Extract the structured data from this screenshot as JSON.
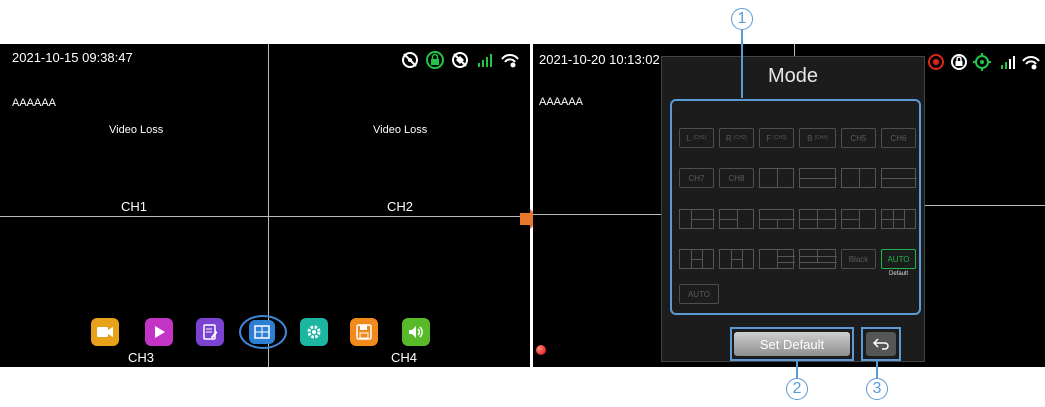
{
  "left_screen": {
    "timestamp": "2021-10-15 09:38:47",
    "plate": "AAAAAA",
    "ch1_status": "Video Loss",
    "ch2_status": "Video Loss",
    "channels": [
      "CH1",
      "CH2",
      "CH3",
      "CH4"
    ],
    "status_icons": [
      "gps-off-icon",
      "record-lock-icon",
      "wifi-off-icon",
      "signal-bars-icon",
      "wifi-icon"
    ],
    "dock": [
      {
        "name": "camera",
        "color": "#e6a21a"
      },
      {
        "name": "playback",
        "color": "#c233c6"
      },
      {
        "name": "notes",
        "color": "#7a43d1"
      },
      {
        "name": "layout",
        "color": "#2d7fd6"
      },
      {
        "name": "settings",
        "color": "#1fb5a3"
      },
      {
        "name": "storage",
        "color": "#f08a1c"
      },
      {
        "name": "volume",
        "color": "#58b92a"
      }
    ]
  },
  "right_screen": {
    "timestamp": "2021-10-20 10:13:02",
    "plate": "AAAAAA",
    "status_icons": [
      "record-icon",
      "lock-icon",
      "gps-icon",
      "signal-bars-icon",
      "wifi-icon"
    ]
  },
  "mode_dialog": {
    "title": "Mode",
    "row1": [
      {
        "label": "L",
        "sub": "(CH1)"
      },
      {
        "label": "R",
        "sub": "(CH2)"
      },
      {
        "label": "F",
        "sub": "(CH3)"
      },
      {
        "label": "B",
        "sub": "(CH4)"
      },
      {
        "label": "CH5",
        "sub": ""
      },
      {
        "label": "CH6",
        "sub": ""
      }
    ],
    "row2": [
      "CH7",
      "CH8"
    ],
    "black_label": "Black",
    "auto_label": "AUTO",
    "default_label": "Default",
    "auto2_label": "AUTO",
    "set_default_label": "Set Default",
    "back_icon": "back-arrow-icon"
  },
  "callouts": [
    "1",
    "2",
    "3"
  ],
  "colors": {
    "callout": "#5b9bd5",
    "arrow": "#e8762b",
    "auto_green": "#22b14c"
  }
}
